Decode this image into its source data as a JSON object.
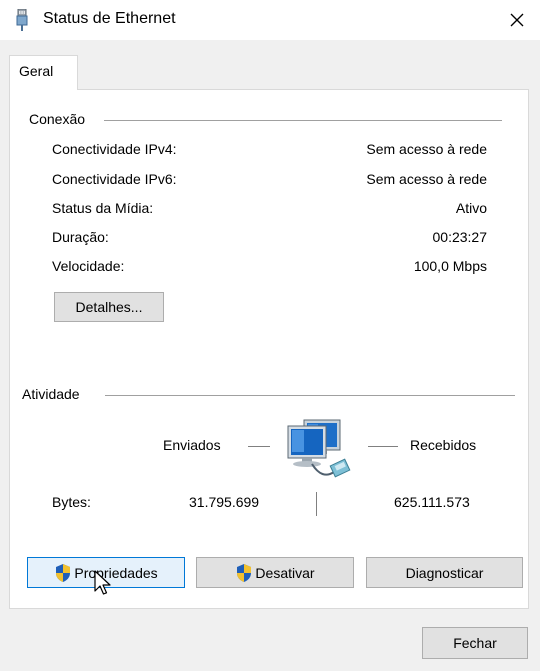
{
  "window": {
    "title": "Status de Ethernet",
    "icons": {
      "app": "ethernet-plug-icon",
      "close": "close-icon"
    }
  },
  "tabs": [
    {
      "label": "Geral",
      "selected": true
    }
  ],
  "connection": {
    "group_label": "Conexão",
    "rows": [
      {
        "label": "Conectividade IPv4:",
        "value": "Sem acesso à rede"
      },
      {
        "label": "Conectividade IPv6:",
        "value": "Sem acesso à rede"
      },
      {
        "label": "Status da Mídia:",
        "value": "Ativo"
      },
      {
        "label": "Duração:",
        "value": "00:23:27"
      },
      {
        "label": "Velocidade:",
        "value": "100,0 Mbps"
      }
    ],
    "details_button": "Detalhes..."
  },
  "activity": {
    "group_label": "Atividade",
    "sent_label": "Enviados",
    "received_label": "Recebidos",
    "bytes_label": "Bytes:",
    "bytes_sent": "31.795.699",
    "bytes_received": "625.111.573",
    "icon": "network-computers-icon"
  },
  "buttons": {
    "properties": "Propriedades",
    "disable": "Desativar",
    "diagnose": "Diagnosticar",
    "close": "Fechar"
  },
  "colors": {
    "focus_border": "#0078d7",
    "button_face": "#e1e1e1",
    "dialog_bg": "#f0f0f0"
  }
}
